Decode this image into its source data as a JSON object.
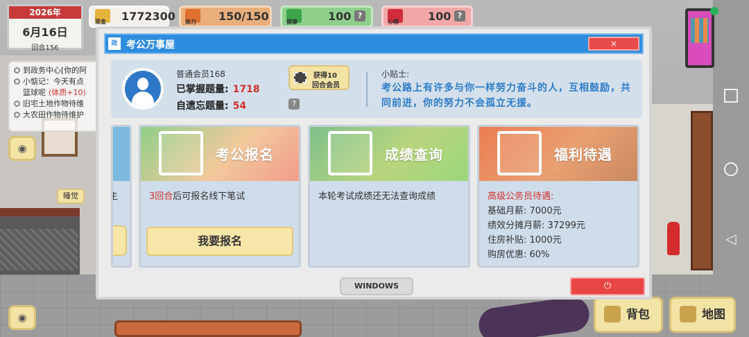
{
  "hud": {
    "year": "2026年",
    "date": "6月16日",
    "round": "回合156",
    "money_label": "现金",
    "money": "1772300",
    "stamina_label": "体力",
    "stamina": "150/150",
    "health_label": "健康",
    "health": "100",
    "mood_label": "心情",
    "mood": "100",
    "help": "?"
  },
  "notes": [
    {
      "text": "到政务中心[你的阿"
    },
    {
      "text": "小惦记：今天有点"
    },
    {
      "text": "篮球呢",
      "bonus": "(体质+10)"
    },
    {
      "text": "旧宅土地作物待维"
    },
    {
      "text": "大农田作物待维护"
    }
  ],
  "sleep_label": "睡觉",
  "eye_icon_glyph": "◉",
  "bottom": {
    "bag": "背包",
    "map": "地图"
  },
  "modal": {
    "logo": "政",
    "title": "考公万事屋",
    "close": "×",
    "member": {
      "level": "普通会员168",
      "mastered_label": "已掌握题量:",
      "mastered_value": "1718",
      "forgotten_label": "自遗忘题量:",
      "forgotten_value": "54",
      "get_line1": "获得10",
      "get_line2": "回合会员",
      "help": "?"
    },
    "tip": {
      "label": "小贴士:",
      "text": "考公路上有许多与你一样努力奋斗的人，互相鼓励，共同前进，你的努力不会孤立无援。"
    },
    "cards": {
      "partial_text": "主",
      "signup": {
        "title": "考公报名",
        "rounds": "3回合",
        "desc": "后可报名线下笔试",
        "button": "我要报名"
      },
      "query": {
        "title": "成绩查询",
        "desc": "本轮考试成绩还无法查询成绩"
      },
      "welfare": {
        "title": "福利待遇",
        "heading": "高级公务员待遇:",
        "lines": [
          "基础月薪: 7000元",
          "绩效分摊月薪: 37299元",
          "住房补贴: 1000元",
          "购房优惠: 60%"
        ]
      }
    },
    "windows_button": "WINDOWS",
    "power_button": "⏻"
  },
  "colors": {
    "title_blue": "#2f8de0",
    "accent_red": "#d2322d",
    "button_yellow": "#f8e6a8"
  }
}
